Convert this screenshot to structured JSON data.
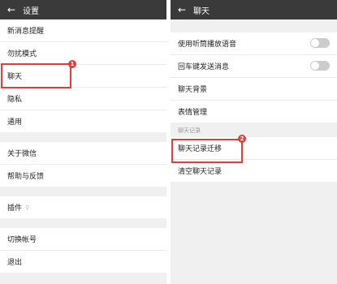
{
  "left": {
    "title": "设置",
    "group1": [
      "新消息提醒",
      "勿扰模式",
      "聊天",
      "隐私",
      "通用"
    ],
    "group2": [
      "关于微信",
      "帮助与反馈"
    ],
    "plugins": "插件",
    "group3": [
      "切换帐号",
      "退出"
    ],
    "badge": "1"
  },
  "right": {
    "title": "聊天",
    "group1": [
      "使用听筒播放语音",
      "回车键发送消息",
      "聊天背景",
      "表情管理"
    ],
    "section_label": "聊天记录",
    "group2": [
      "聊天记录迁移",
      "清空聊天记录"
    ],
    "badge": "2"
  },
  "colors": {
    "titlebar": "#3a3a3a",
    "highlight": "#e63b3b",
    "background": "#f0f0f0"
  }
}
